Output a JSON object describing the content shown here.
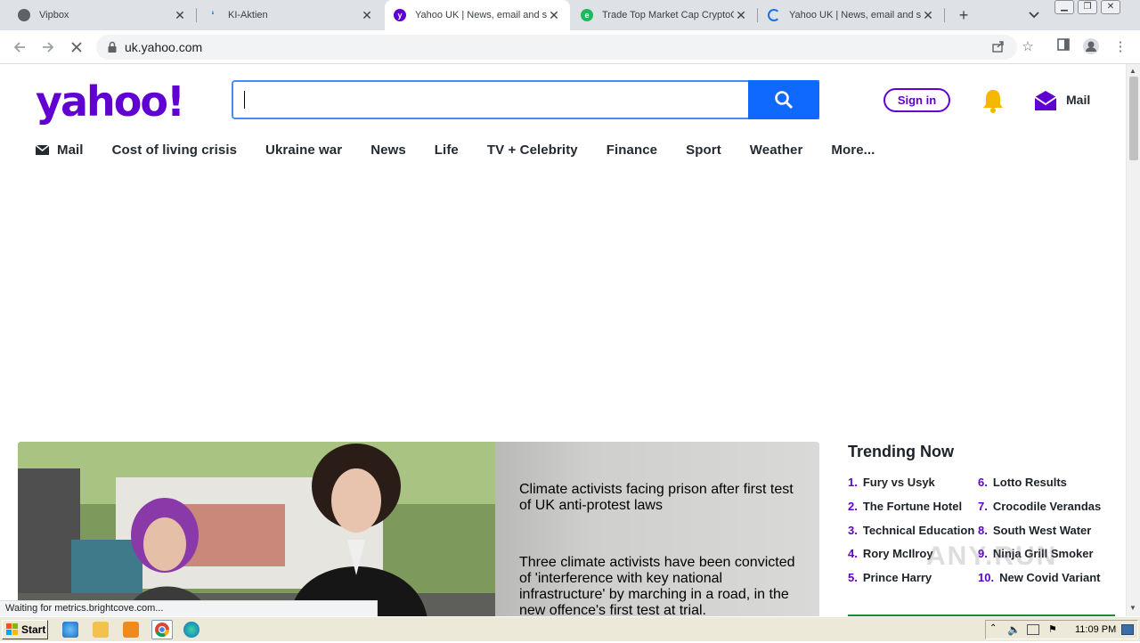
{
  "browser": {
    "tabs": [
      {
        "title": "Vipbox",
        "active": false
      },
      {
        "title": "KI-Aktien",
        "active": false
      },
      {
        "title": "Yahoo UK | News, email and se",
        "active": true
      },
      {
        "title": "Trade Top Market Cap CryptoC",
        "active": false
      },
      {
        "title": "Yahoo UK | News, email and se",
        "active": false
      }
    ],
    "new_tab_label": "+",
    "url": "uk.yahoo.com",
    "status_text": "Waiting for metrics.brightcove.com..."
  },
  "header": {
    "logo_text": "yahoo!",
    "search_value": "",
    "signin_label": "Sign in",
    "mail_label": "Mail"
  },
  "nav": {
    "items": [
      "Mail",
      "Cost of living crisis",
      "Ukraine war",
      "News",
      "Life",
      "TV + Celebrity",
      "Finance",
      "Sport",
      "Weather",
      "More..."
    ]
  },
  "hero": {
    "headline": "Climate activists facing prison after first test of UK anti-protest laws",
    "summary": "Three climate activists have been convicted of 'interference with key national infrastructure' by marching in a road, in the new offence's first test at trial."
  },
  "trending": {
    "title": "Trending Now",
    "items": [
      {
        "num": "1.",
        "label": "Fury vs Usyk"
      },
      {
        "num": "2.",
        "label": "The Fortune Hotel"
      },
      {
        "num": "3.",
        "label": "Technical Education"
      },
      {
        "num": "4.",
        "label": "Rory McIlroy"
      },
      {
        "num": "5.",
        "label": "Prince Harry"
      },
      {
        "num": "6.",
        "label": "Lotto Results"
      },
      {
        "num": "7.",
        "label": "Crocodile Verandas"
      },
      {
        "num": "8.",
        "label": "South West Water"
      },
      {
        "num": "9.",
        "label": "Ninja Grill Smoker"
      },
      {
        "num": "10.",
        "label": "New Covid Variant"
      }
    ]
  },
  "watermark": "ANY.RUN",
  "taskbar": {
    "start_label": "Start",
    "clock": "11:09 PM"
  },
  "colors": {
    "yahoo_purple": "#6001d2",
    "search_blue": "#0f69ff",
    "bell_yellow": "#f5b700"
  }
}
